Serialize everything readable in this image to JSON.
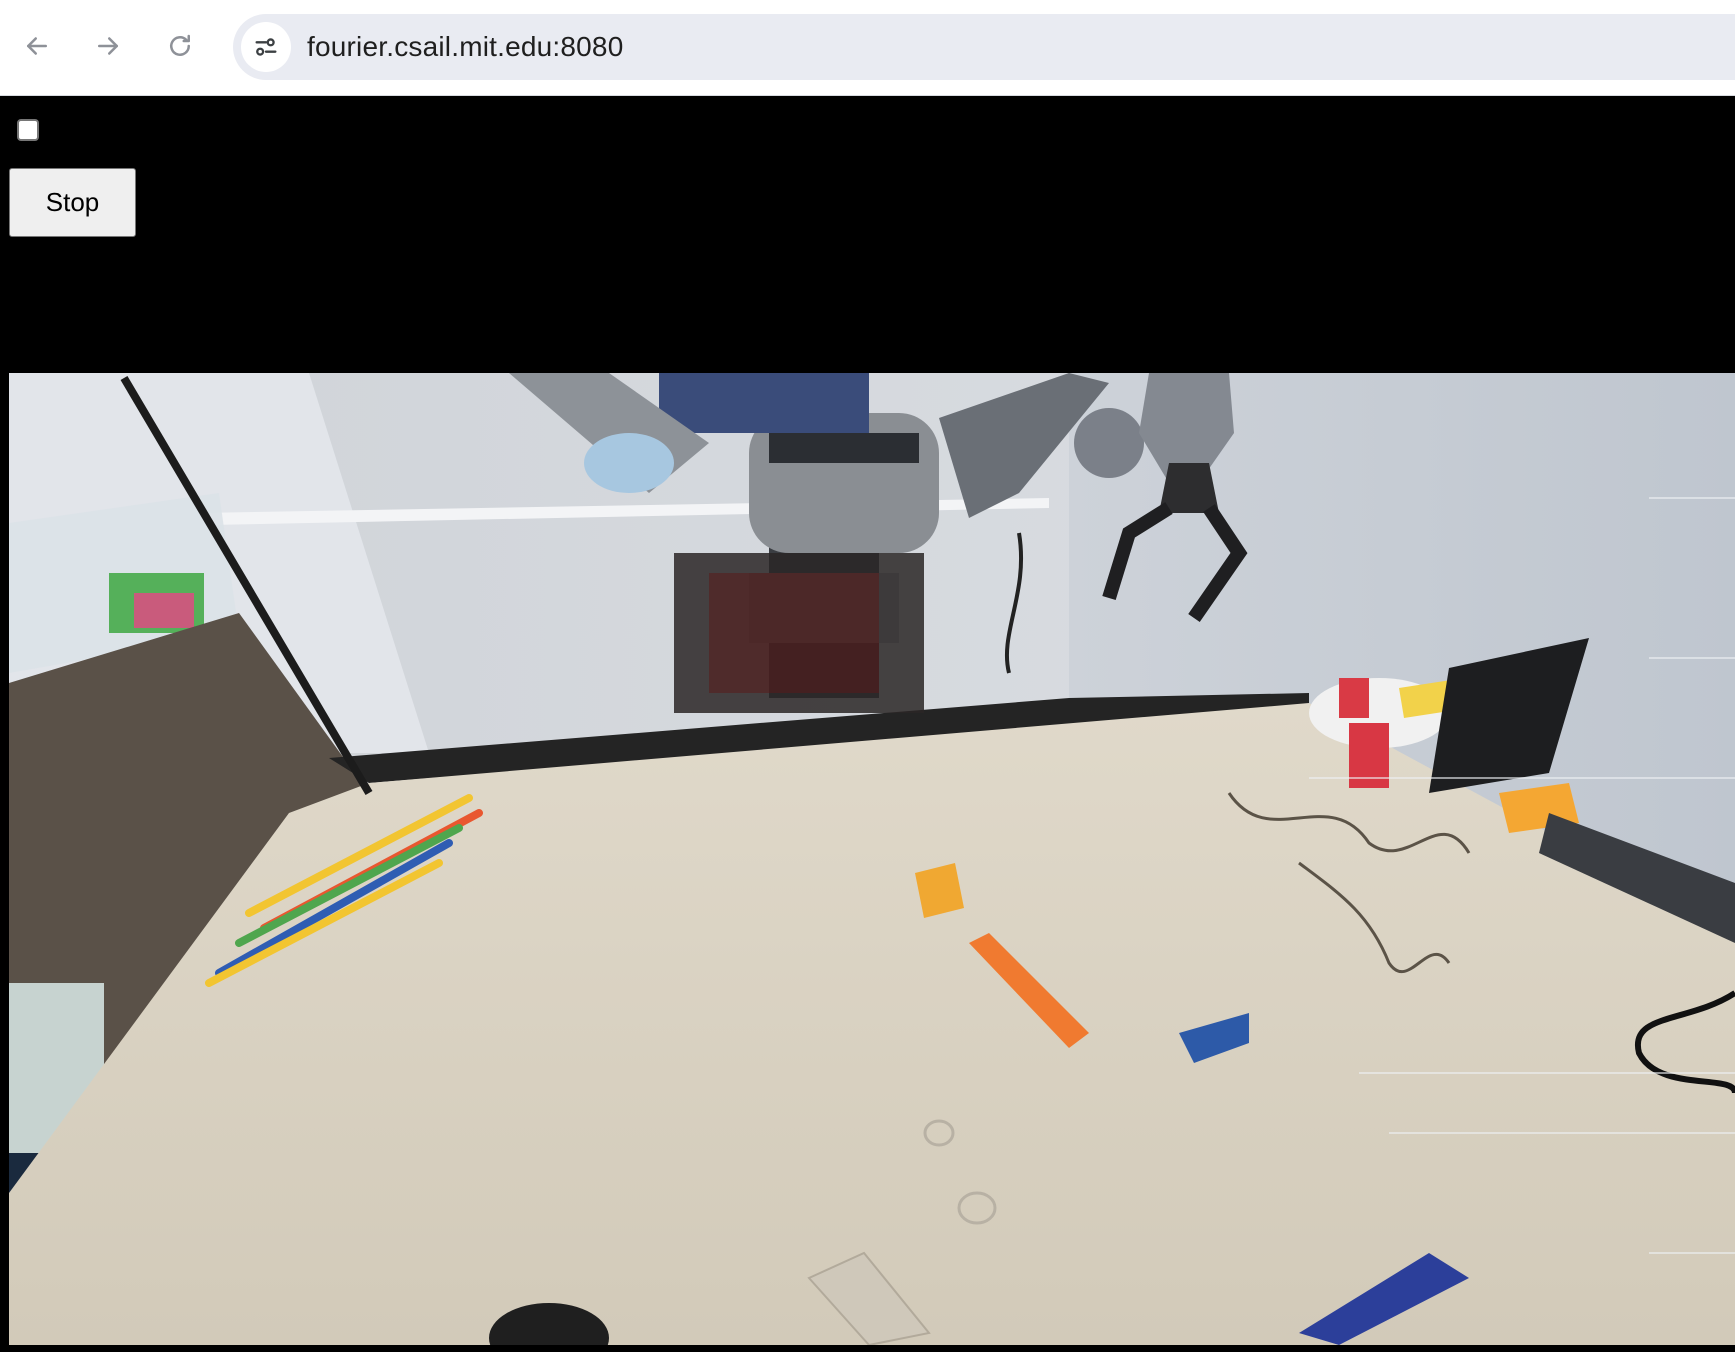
{
  "browser": {
    "url": "fourier.csail.mit.edu:8080",
    "icons": {
      "back": "arrow-left-icon",
      "forward": "arrow-right-icon",
      "reload": "reload-icon",
      "site_info": "tune-icon"
    }
  },
  "page": {
    "checkbox_checked": false,
    "stop_label": "Stop",
    "background_color": "#000000"
  },
  "camera_feed": {
    "description": "live camera view of dual-arm robot and tabletop"
  }
}
